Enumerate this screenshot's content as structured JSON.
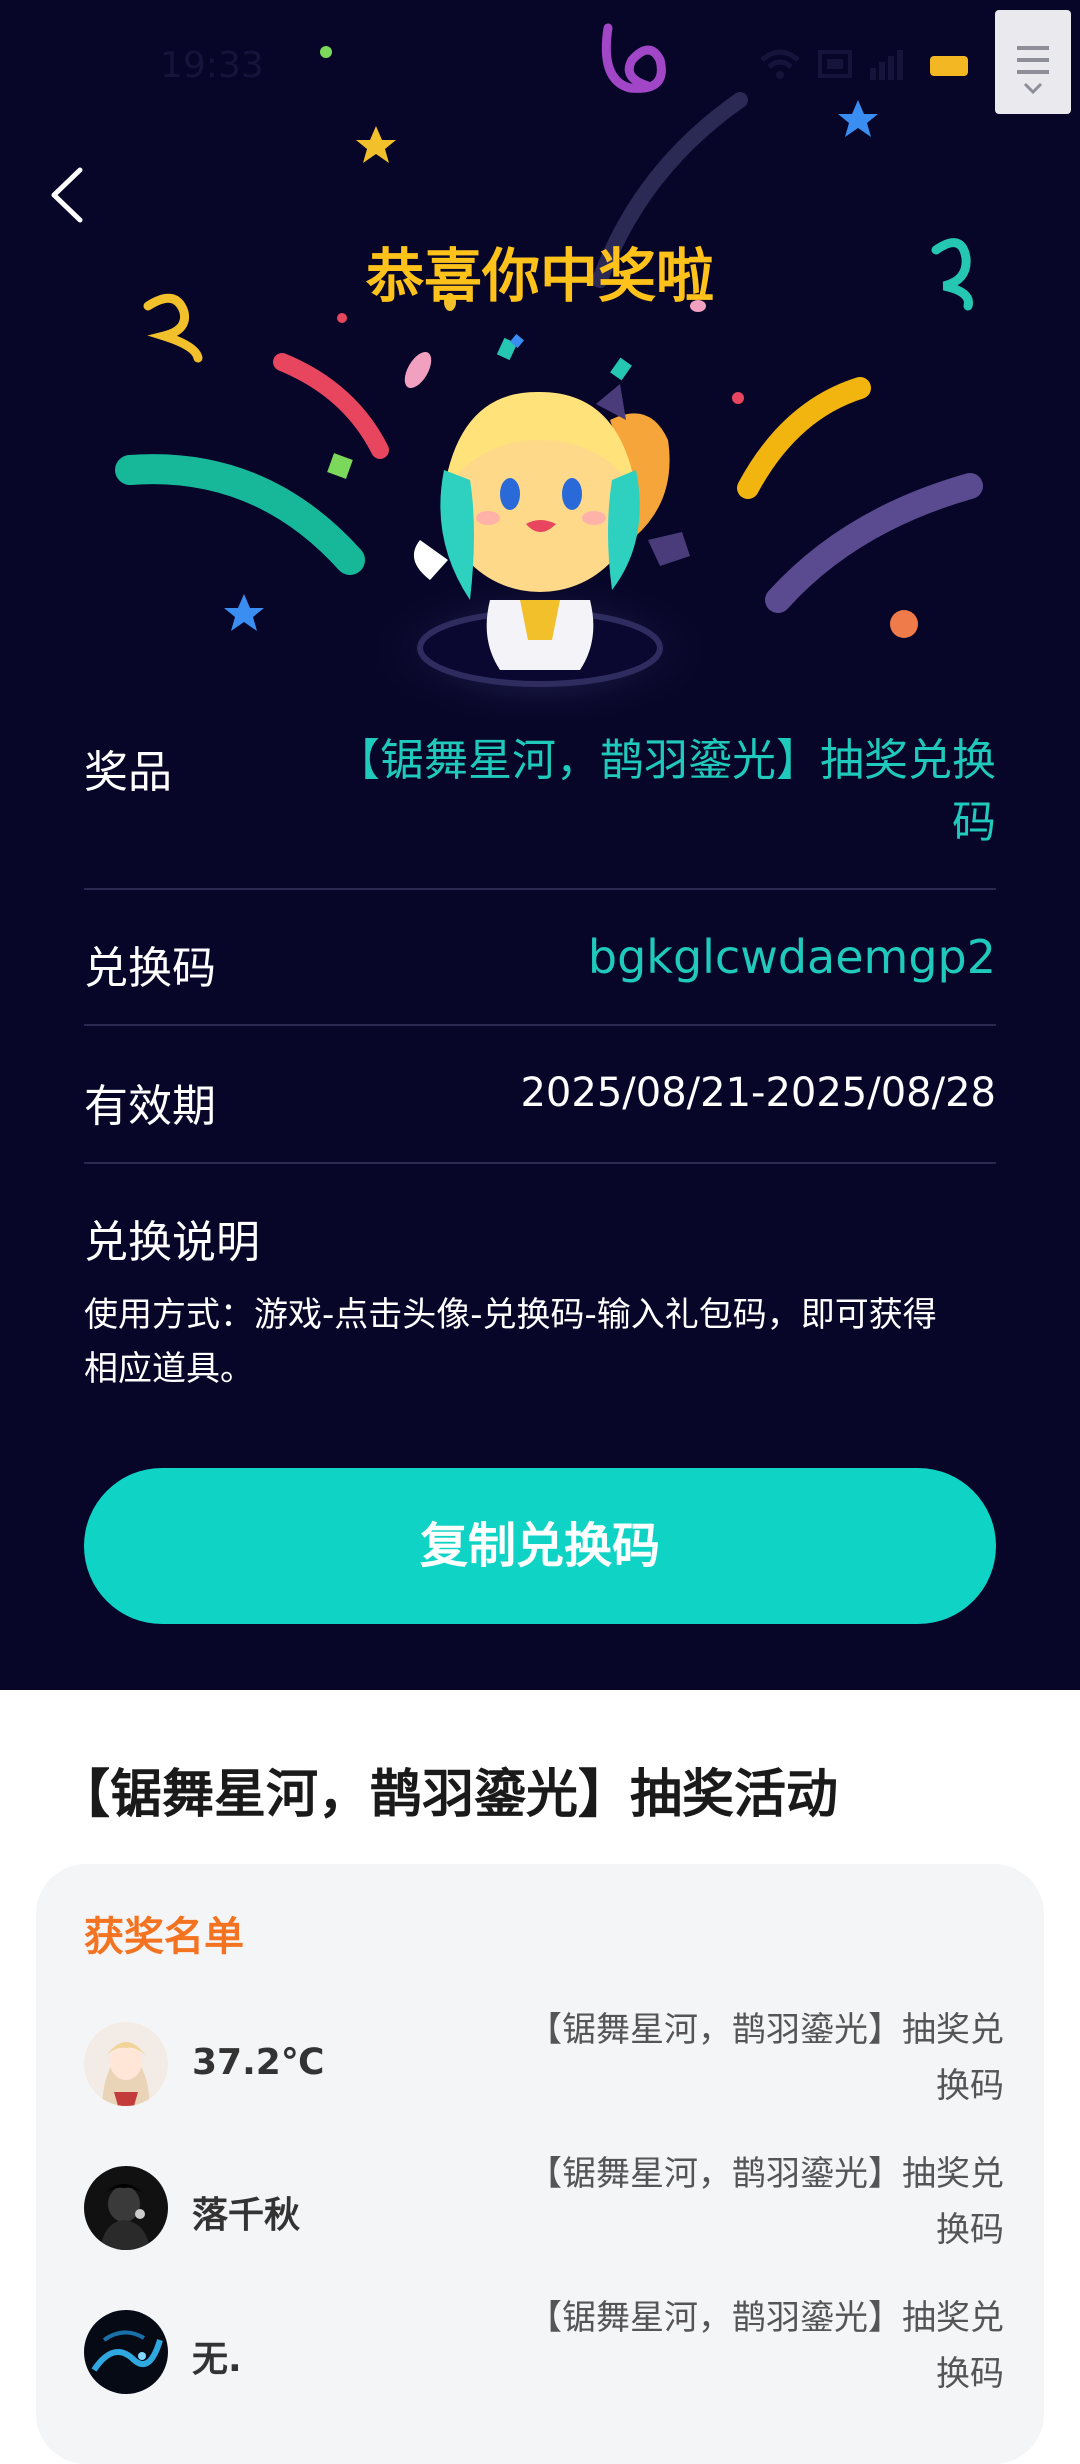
{
  "status_bar": {
    "time": "19:33"
  },
  "header": {
    "title": "恭喜你中奖啦"
  },
  "prize": {
    "label": "奖品",
    "value_line1": "【锯舞星河，鹊羽鎏光】抽奖兑换",
    "value_line2": "码"
  },
  "code": {
    "label": "兑换码",
    "value": "bgkglcwdaemgp2"
  },
  "validity": {
    "label": "有效期",
    "value": "2025/08/21-2025/08/28"
  },
  "instructions": {
    "label": "兑换说明",
    "line1": "使用方式：游戏-点击头像-兑换码-输入礼包码，即可获得",
    "line2": "相应道具。"
  },
  "copy_button": {
    "label": "复制兑换码"
  },
  "activity": {
    "title": "【锯舞星河，鹊羽鎏光】抽奖活动"
  },
  "winners": {
    "title": "获奖名单",
    "items": [
      {
        "name": "37.2℃",
        "prize_line1": "【锯舞星河，鹊羽鎏光】抽奖兑",
        "prize_line2": "换码"
      },
      {
        "name": "落千秋",
        "prize_line1": "【锯舞星河，鹊羽鎏光】抽奖兑",
        "prize_line2": "换码"
      },
      {
        "name": "无.",
        "prize_line1": "【锯舞星河，鹊羽鎏光】抽奖兑",
        "prize_line2": "换码"
      }
    ]
  },
  "colors": {
    "background": "#070628",
    "title": "#ffc21a",
    "accent": "#0fd3c5",
    "teal_text": "#1fc9bb",
    "winners_title": "#f37321"
  }
}
